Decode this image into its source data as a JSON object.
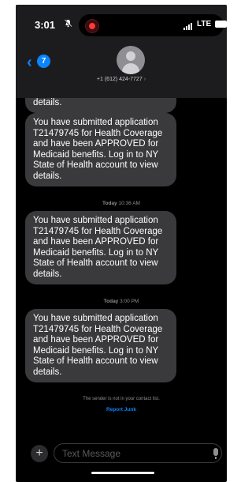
{
  "status_bar": {
    "time": "3:01",
    "network": "LTE"
  },
  "header": {
    "back_count": "7",
    "phone_number": "+1 (612) 424-7727",
    "chevron": "›"
  },
  "messages": [
    {
      "text": "State of Health account to view details."
    },
    {
      "text": "You have submitted application T21479745 for Health Coverage and have been APPROVED for Medicaid benefits. Log in to NY State of Health account to view details."
    },
    {
      "text": "You have submitted application T21479745 for Health Coverage and have been APPROVED for Medicaid benefits. Log in to NY State of Health account to view details."
    },
    {
      "text": "You have submitted application T21479745 for Health Coverage and have been APPROVED for Medicaid benefits. Log in to NY State of Health account to view details."
    }
  ],
  "timestamps": [
    {
      "day": "Today",
      "time": "10:36 AM"
    },
    {
      "day": "Today",
      "time": "3:00 PM"
    }
  ],
  "footer_note": {
    "sender_note": "The sender is not in your contact list.",
    "report_label": "Report Junk"
  },
  "composer": {
    "placeholder": "Text Message"
  },
  "icons": [
    "bell-slash-icon",
    "recording-indicator-icon",
    "signal-icon",
    "battery-icon",
    "back-chevron-icon",
    "avatar-icon",
    "plus-icon",
    "microphone-icon"
  ],
  "colors": {
    "bubble": "#3a3a3c",
    "accent": "#0a84ff",
    "background": "#000000",
    "header": "#1c1c1e"
  }
}
